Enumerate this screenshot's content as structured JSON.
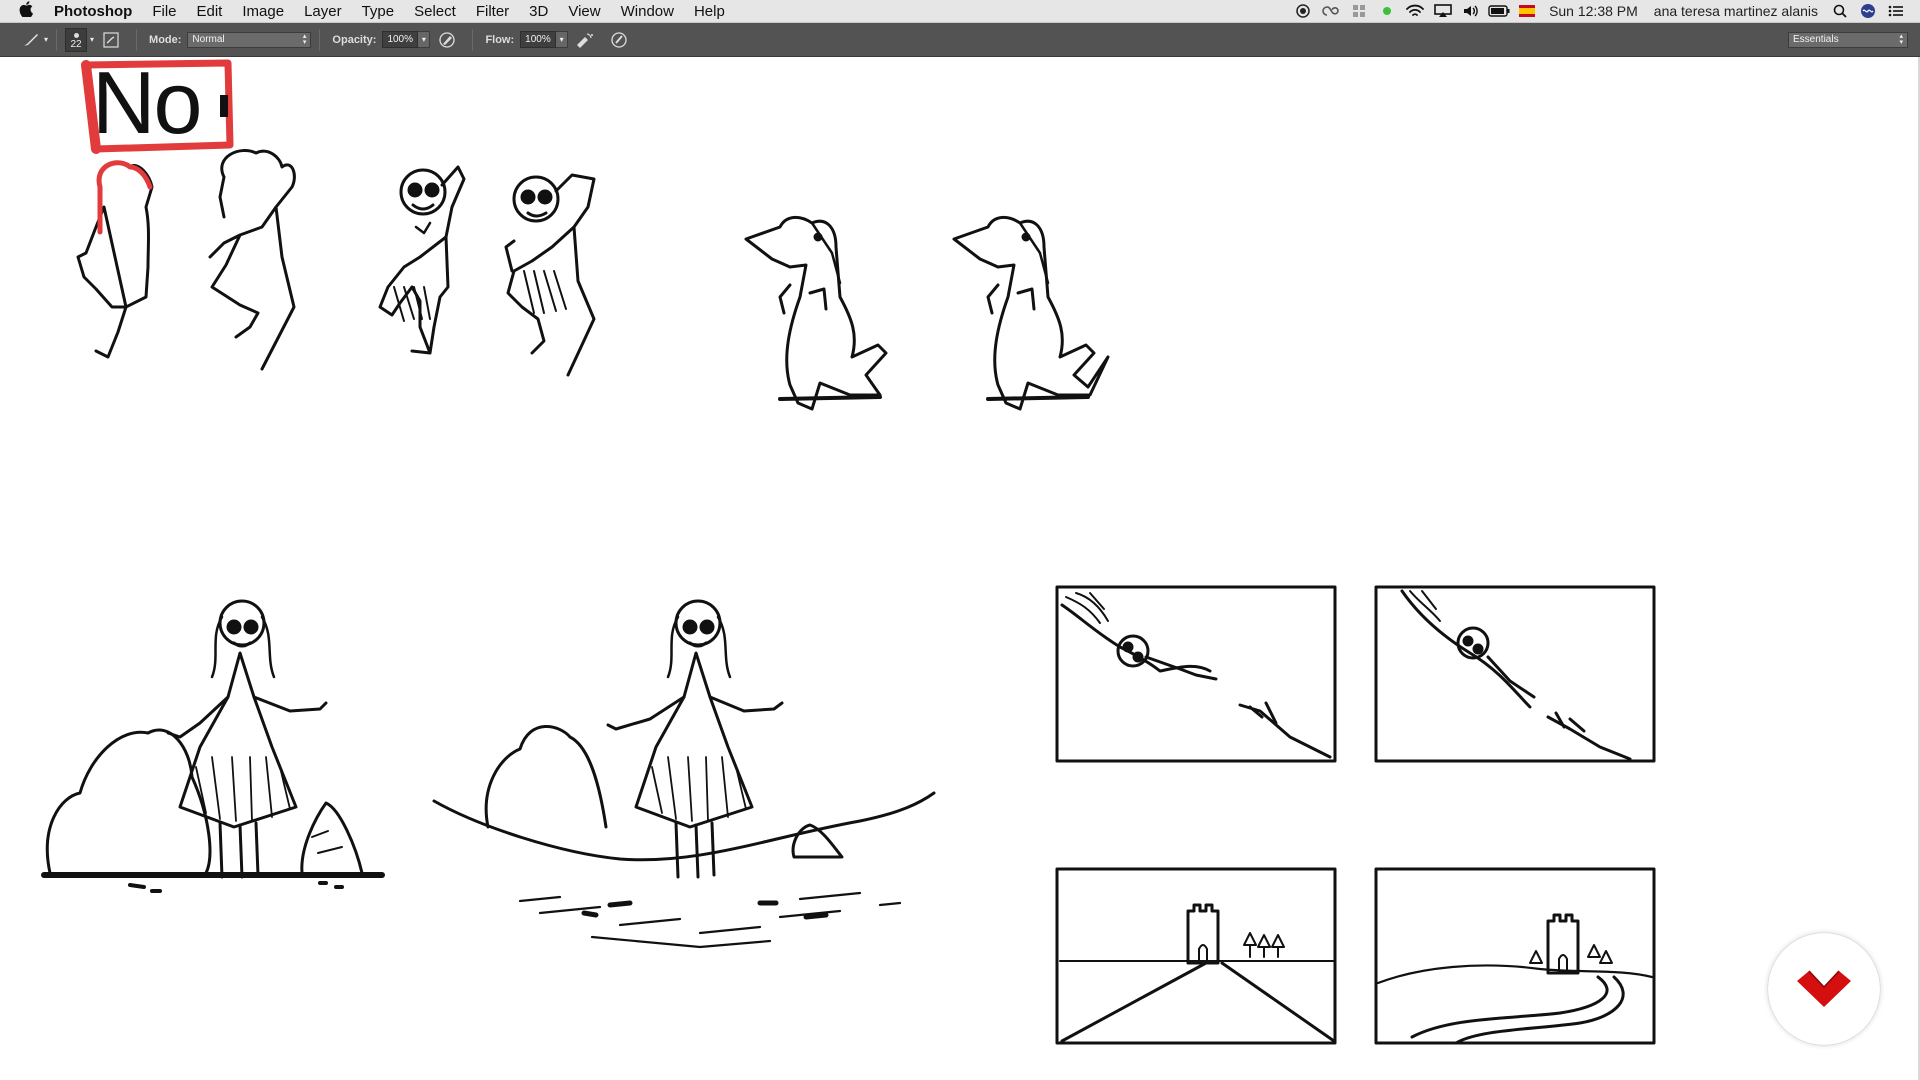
{
  "menubar": {
    "app_name": "Photoshop",
    "menus": [
      "File",
      "Edit",
      "Image",
      "Layer",
      "Type",
      "Select",
      "Filter",
      "3D",
      "View",
      "Window",
      "Help"
    ],
    "clock": "Sun 12:38 PM",
    "user": "ana teresa martinez alanis",
    "status_icons": [
      "record-icon",
      "creative-cloud-icon",
      "grid-icon",
      "green-dot-icon",
      "wifi-icon",
      "airplay-icon",
      "volume-icon",
      "battery-icon",
      "flag-icon"
    ]
  },
  "options": {
    "brush_size": "22",
    "mode_label": "Mode:",
    "mode_value": "Normal",
    "opacity_label": "Opacity:",
    "opacity_value": "100%",
    "flow_label": "Flow:",
    "flow_value": "100%",
    "workspace": "Essentials"
  },
  "canvas": {
    "note_text": "No",
    "ink_color": "#111111",
    "highlight_color": "#e23b3b"
  },
  "badge": {
    "color": "#d50f0f"
  }
}
